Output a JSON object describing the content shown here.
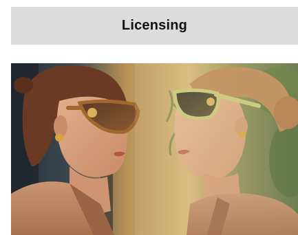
{
  "section": {
    "label": "Licensing"
  },
  "hero_image": {
    "icon": "campaign-photo-two-women-sunglasses",
    "colors": {
      "background_left": "#2b3640",
      "background_warm": "#c9a46a",
      "skin": "#d9a583",
      "hair_left": "#6b3a24",
      "hair_right": "#c08a5a",
      "jacket": "#b9855f",
      "sunglasses_left": "#a0682e",
      "sunglasses_right": "#c9c77a",
      "foliage": "#6f8a4a"
    }
  }
}
